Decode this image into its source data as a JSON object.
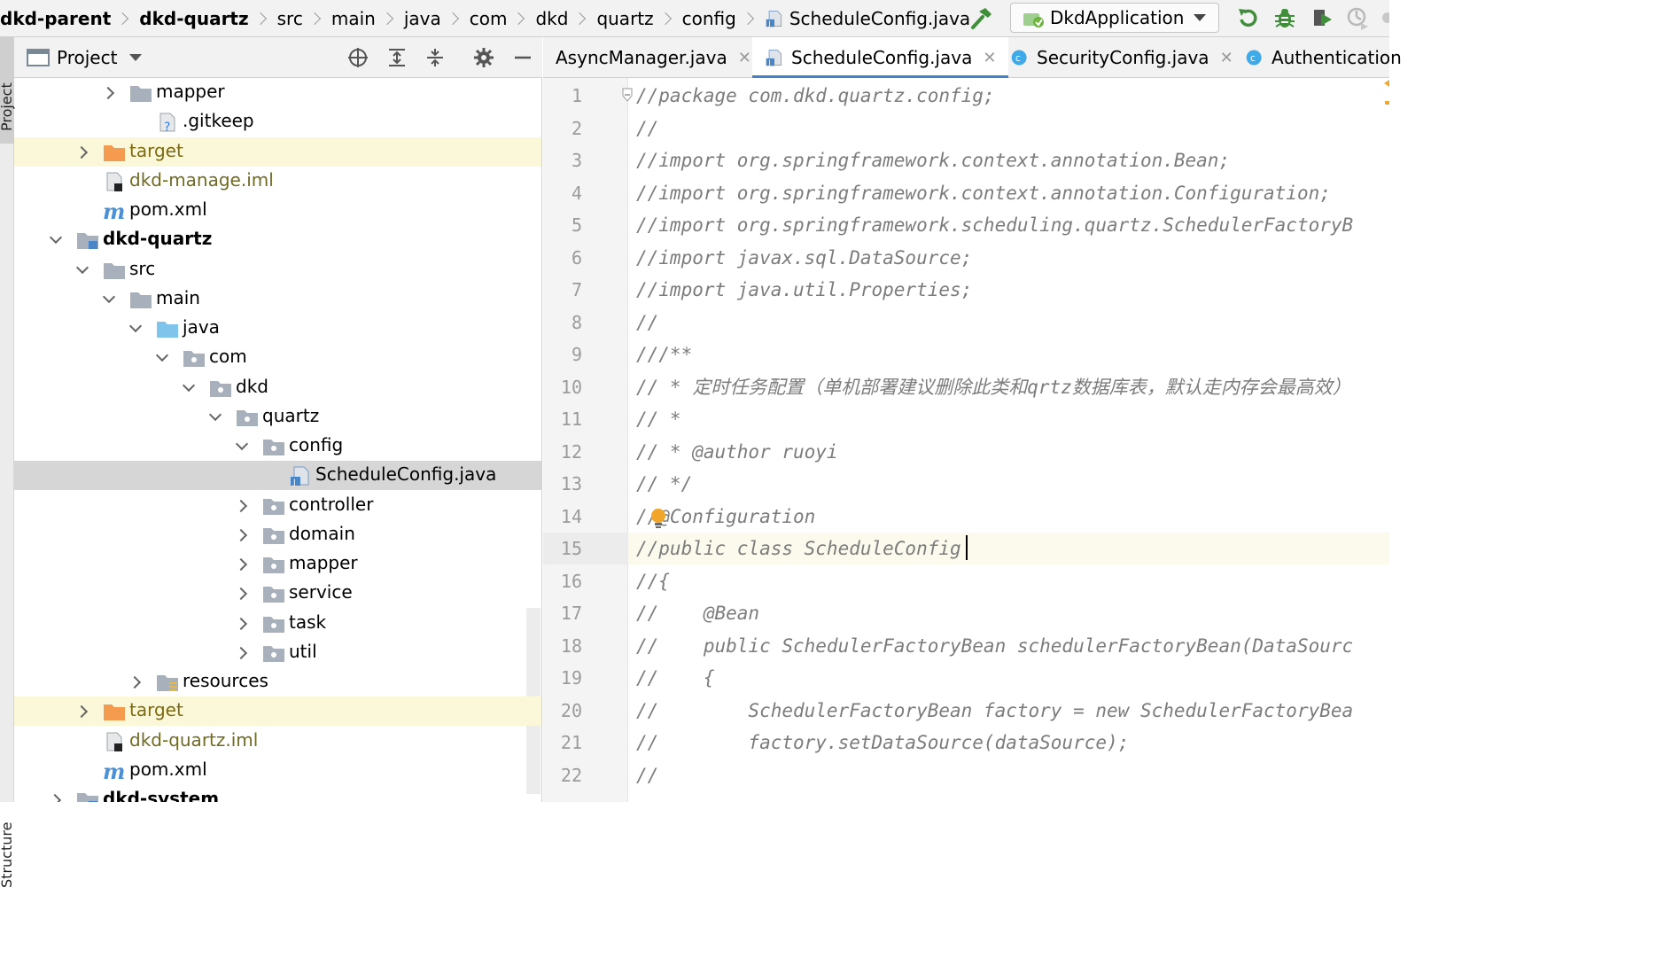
{
  "breadcrumbs": [
    "dkd-parent",
    "dkd-quartz",
    "src",
    "main",
    "java",
    "com",
    "dkd",
    "quartz",
    "config",
    "ScheduleConfig.java"
  ],
  "run_config": {
    "label": "DkdApplication"
  },
  "toolbar_icons": [
    "hammer-icon",
    "rerun-icon",
    "debug-icon",
    "coverage-icon",
    "profiler-icon"
  ],
  "side_stripe": {
    "top_label": "Project",
    "bottom_label": "Structure"
  },
  "project_panel": {
    "title": "Project",
    "tree": [
      {
        "label": "mapper",
        "icon": "folder-icon",
        "chevron": "right",
        "style": "normal"
      },
      {
        "label": ".gitkeep",
        "icon": "unknown-file-icon",
        "chevron": "none",
        "style": "normal"
      },
      {
        "label": "target",
        "icon": "excluded-folder-icon",
        "chevron": "right",
        "style": "excluded"
      },
      {
        "label": "dkd-manage.iml",
        "icon": "iml-file-icon",
        "chevron": "none",
        "style": "iml"
      },
      {
        "label": "pom.xml",
        "icon": "maven-icon",
        "chevron": "none",
        "style": "normal"
      },
      {
        "label": "dkd-quartz",
        "icon": "module-folder-icon",
        "chevron": "down",
        "style": "bold"
      },
      {
        "label": "src",
        "icon": "folder-icon",
        "chevron": "down",
        "style": "normal"
      },
      {
        "label": "main",
        "icon": "folder-icon",
        "chevron": "down",
        "style": "normal"
      },
      {
        "label": "java",
        "icon": "source-folder-icon",
        "chevron": "down",
        "style": "normal"
      },
      {
        "label": "com",
        "icon": "package-icon",
        "chevron": "down",
        "style": "normal"
      },
      {
        "label": "dkd",
        "icon": "package-icon",
        "chevron": "down",
        "style": "normal"
      },
      {
        "label": "quartz",
        "icon": "package-icon",
        "chevron": "down",
        "style": "normal"
      },
      {
        "label": "config",
        "icon": "package-icon",
        "chevron": "down",
        "style": "normal"
      },
      {
        "label": "ScheduleConfig.java",
        "icon": "java-file-icon",
        "chevron": "none",
        "style": "selected"
      },
      {
        "label": "controller",
        "icon": "package-icon",
        "chevron": "right",
        "style": "normal"
      },
      {
        "label": "domain",
        "icon": "package-icon",
        "chevron": "right",
        "style": "normal"
      },
      {
        "label": "mapper",
        "icon": "package-icon",
        "chevron": "right",
        "style": "normal"
      },
      {
        "label": "service",
        "icon": "package-icon",
        "chevron": "right",
        "style": "normal"
      },
      {
        "label": "task",
        "icon": "package-icon",
        "chevron": "right",
        "style": "normal"
      },
      {
        "label": "util",
        "icon": "package-icon",
        "chevron": "right",
        "style": "normal"
      },
      {
        "label": "resources",
        "icon": "resources-folder-icon",
        "chevron": "right",
        "style": "normal"
      },
      {
        "label": "target",
        "icon": "excluded-folder-icon",
        "chevron": "right",
        "style": "excluded"
      },
      {
        "label": "dkd-quartz.iml",
        "icon": "iml-file-icon",
        "chevron": "none",
        "style": "iml"
      },
      {
        "label": "pom.xml",
        "icon": "maven-icon",
        "chevron": "none",
        "style": "normal"
      },
      {
        "label": "dkd-system",
        "icon": "module-folder-icon",
        "chevron": "right",
        "style": "bold"
      }
    ]
  },
  "tabs": [
    {
      "label": "AsyncManager.java",
      "icon": "java-file-icon",
      "active": false,
      "closable": true
    },
    {
      "label": "ScheduleConfig.java",
      "icon": "java-file-icon",
      "active": true,
      "closable": true
    },
    {
      "label": "SecurityConfig.java",
      "icon": "class-icon",
      "active": false,
      "closable": true
    },
    {
      "label": "Authentication",
      "icon": "class-icon",
      "active": false,
      "closable": false
    }
  ],
  "editor": {
    "current_line": 15,
    "lines": [
      {
        "n": "1",
        "text": "//package com.dkd.quartz.config;"
      },
      {
        "n": "2",
        "text": "//"
      },
      {
        "n": "3",
        "text": "//import org.springframework.context.annotation.Bean;"
      },
      {
        "n": "4",
        "text": "//import org.springframework.context.annotation.Configuration;"
      },
      {
        "n": "5",
        "text": "//import org.springframework.scheduling.quartz.SchedulerFactoryB"
      },
      {
        "n": "6",
        "text": "//import javax.sql.DataSource;"
      },
      {
        "n": "7",
        "text": "//import java.util.Properties;"
      },
      {
        "n": "8",
        "text": "//"
      },
      {
        "n": "9",
        "text": "///**"
      },
      {
        "n": "10",
        "text": "// * 定时任务配置（单机部署建议删除此类和qrtz数据库表，默认走内存会最高效）"
      },
      {
        "n": "11",
        "text": "// *"
      },
      {
        "n": "12",
        "text": "// * @author ruoyi"
      },
      {
        "n": "13",
        "text": "// */"
      },
      {
        "n": "14",
        "text": "//@Configuration"
      },
      {
        "n": "15",
        "text": "//public class ScheduleConfig"
      },
      {
        "n": "16",
        "text": "//{"
      },
      {
        "n": "17",
        "text": "//    @Bean"
      },
      {
        "n": "18",
        "text": "//    public SchedulerFactoryBean schedulerFactoryBean(DataSourc"
      },
      {
        "n": "19",
        "text": "//    {"
      },
      {
        "n": "20",
        "text": "//        SchedulerFactoryBean factory = new SchedulerFactoryBea"
      },
      {
        "n": "21",
        "text": "//        factory.setDataSource(dataSource);"
      },
      {
        "n": "22",
        "text": "//"
      }
    ]
  }
}
